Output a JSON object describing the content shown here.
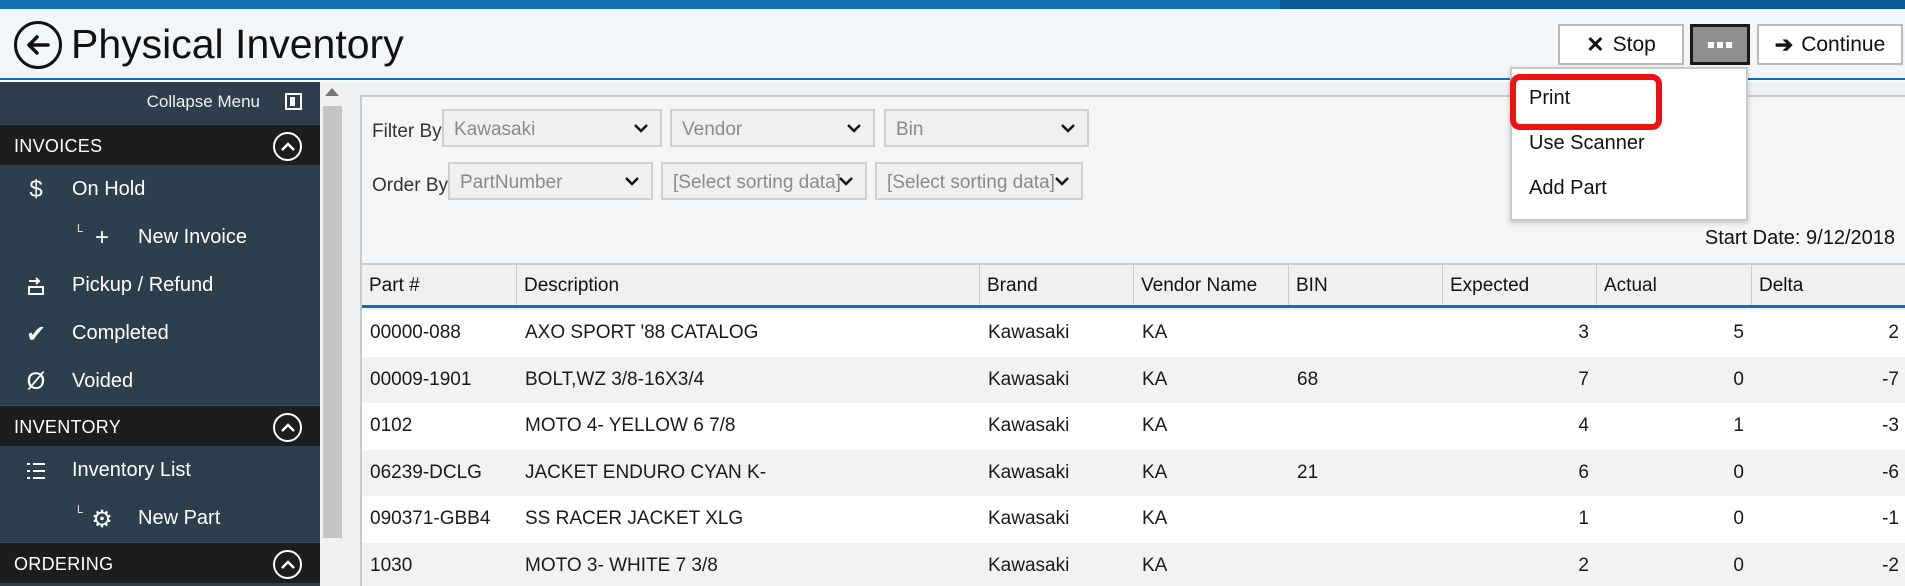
{
  "header": {
    "title": "Physical Inventory",
    "stop_label": "Stop",
    "continue_label": "Continue"
  },
  "sidebar": {
    "collapse_label": "Collapse Menu",
    "sections": [
      {
        "label": "INVOICES",
        "items": [
          {
            "label": "On Hold",
            "icon": "dollar-icon"
          },
          {
            "label": "New Invoice",
            "icon": "plus-icon",
            "sub": true
          },
          {
            "label": "Pickup / Refund",
            "icon": "refund-icon"
          },
          {
            "label": "Completed",
            "icon": "check-icon"
          },
          {
            "label": "Voided",
            "icon": "void-icon"
          }
        ]
      },
      {
        "label": "INVENTORY",
        "items": [
          {
            "label": "Inventory List",
            "icon": "list-icon"
          },
          {
            "label": "New Part",
            "icon": "gear-icon",
            "sub": true
          }
        ]
      },
      {
        "label": "ORDERING",
        "items": []
      }
    ]
  },
  "filters": {
    "filter_by_label": "Filter By:",
    "order_by_label": "Order By:",
    "filter_brand": "Kawasaki",
    "filter_vendor": "Vendor",
    "filter_bin": "Bin",
    "order_1": "PartNumber",
    "order_2": "[Select sorting data]",
    "order_3": "[Select sorting data]"
  },
  "start_date": "Start Date: 9/12/2018",
  "menu": {
    "items": [
      "Print",
      "Use Scanner",
      "Add Part"
    ]
  },
  "table": {
    "columns": [
      "Part #",
      "Description",
      "Brand",
      "Vendor Name",
      "BIN",
      "Expected",
      "Actual",
      "Delta"
    ],
    "rows": [
      [
        "00000-088",
        "AXO SPORT '88 CATALOG",
        "Kawasaki",
        "KA",
        "",
        "3",
        "5",
        "2"
      ],
      [
        "00009-1901",
        "BOLT,WZ 3/8-16X3/4",
        "Kawasaki",
        "KA",
        "68",
        "7",
        "0",
        "-7"
      ],
      [
        "0102",
        "MOTO 4- YELLOW 6 7/8",
        "Kawasaki",
        "KA",
        "",
        "4",
        "1",
        "-3"
      ],
      [
        "06239-DCLG",
        "JACKET ENDURO CYAN K-",
        "Kawasaki",
        "KA",
        "21",
        "6",
        "0",
        "-6"
      ],
      [
        "090371-GBB4",
        "SS RACER JACKET XLG",
        "Kawasaki",
        "KA",
        "",
        "1",
        "0",
        "-1"
      ],
      [
        "1030",
        "MOTO 3- WHITE 7 3/8",
        "Kawasaki",
        "KA",
        "",
        "2",
        "0",
        "-2"
      ]
    ]
  },
  "colors": {
    "accent": "#0f6fb5",
    "sidebar": "#2d3e4d",
    "section_head": "#1d1d1d",
    "highlight": "#ee1111"
  }
}
